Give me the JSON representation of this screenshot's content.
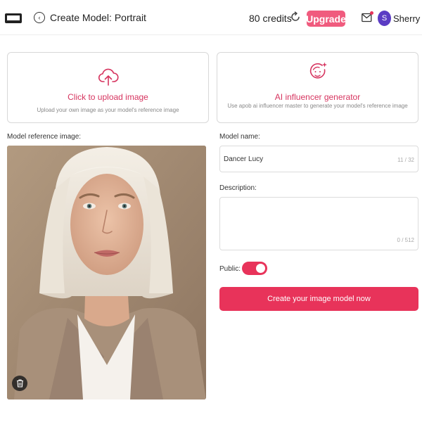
{
  "header": {
    "page_title": "Create Model: Portrait",
    "credits": "80 credits",
    "upgrade_label": "Upgrade",
    "avatar_initial": "S",
    "user_name": "Sherry",
    "icons": [
      "logo-icon",
      "back-arrow-icon",
      "refresh-icon",
      "mail-icon"
    ]
  },
  "cards": {
    "upload": {
      "icon": "cloud-upload-icon",
      "title": "Click to upload image",
      "description": "Upload your own image as your model's reference image"
    },
    "ai_generator": {
      "icon": "ai-face-sparkle-icon",
      "title": "AI influencer generator",
      "description": "Use apob ai influencer master to generate your model's reference image"
    }
  },
  "reference": {
    "label": "Model reference image:",
    "delete_icon": "trash-icon"
  },
  "form": {
    "name_label": "Model name:",
    "name_value": "Dancer Lucy",
    "name_counter": "11 / 32",
    "description_label": "Description:",
    "description_value": "",
    "description_counter": "0 / 512",
    "public_label": "Public:",
    "public_on": true,
    "submit_label": "Create your image model now"
  },
  "colors": {
    "accent": "#e8335a",
    "upgrade": "#f05b7e",
    "card_title": "#d6345f",
    "avatar": "#5b3cc4"
  }
}
